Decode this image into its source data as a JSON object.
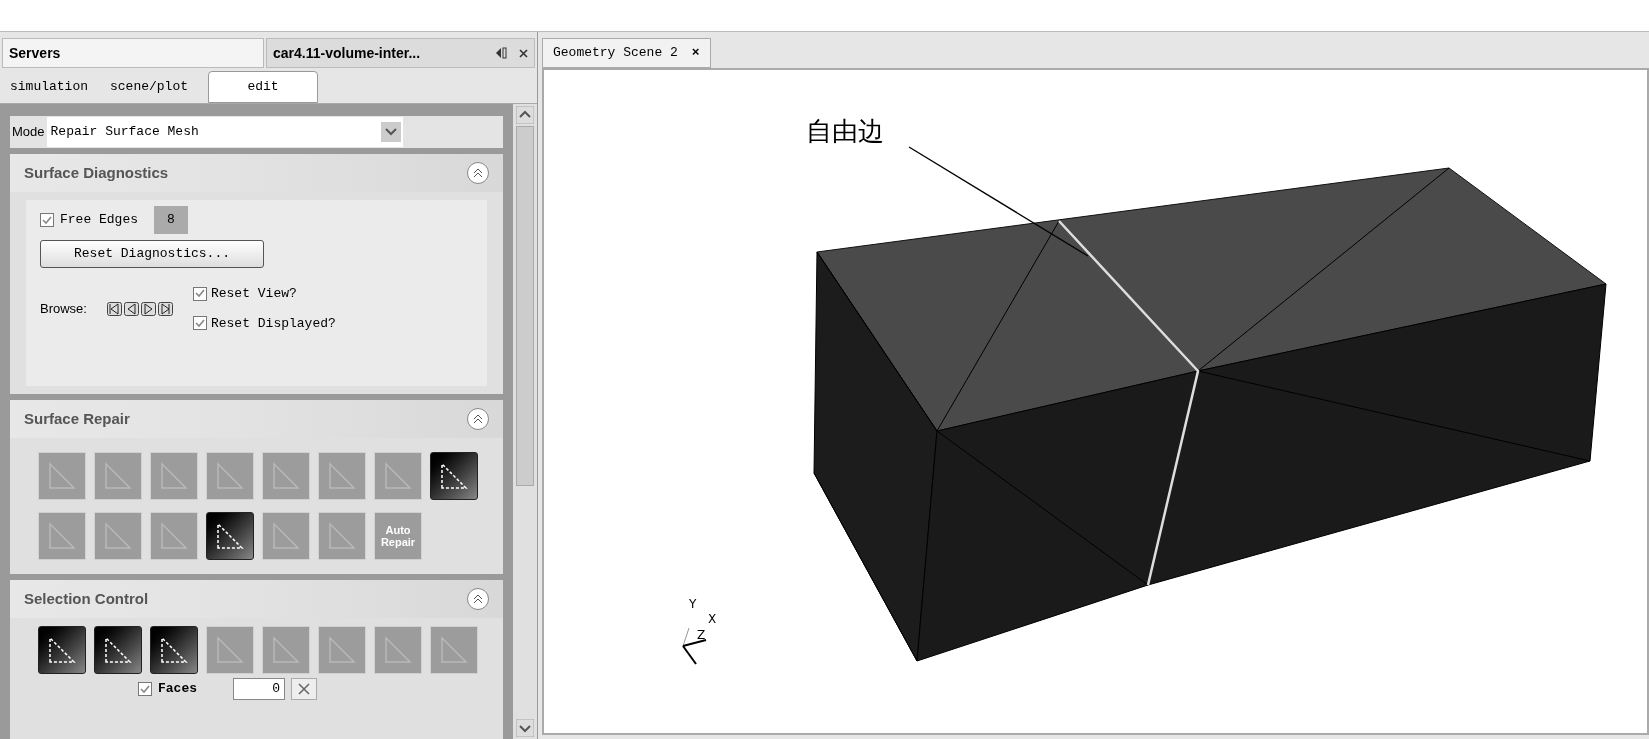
{
  "panel_tabs": [
    {
      "label": "Servers",
      "selected": true
    },
    {
      "label": "car4.11-volume-inter...",
      "selected": false
    }
  ],
  "sub_tabs": [
    {
      "label": "simulation",
      "selected": false
    },
    {
      "label": "scene/plot",
      "selected": false
    },
    {
      "label": "edit",
      "selected": true
    }
  ],
  "mode": {
    "label": "Mode",
    "value": "Repair Surface Mesh"
  },
  "surface_diagnostics": {
    "title": "Surface Diagnostics",
    "expanded": true,
    "free_edges": {
      "label": "Free Edges",
      "checked": true,
      "count": "8"
    },
    "reset_button": "Reset Diagnostics...",
    "browse_label": "Browse:",
    "reset_view": {
      "label": "Reset View?",
      "checked": true
    },
    "reset_displayed": {
      "label": "Reset Displayed?",
      "checked": true
    }
  },
  "surface_repair": {
    "title": "Surface Repair",
    "expanded": true,
    "tools": [
      {
        "selected": false
      },
      {
        "selected": false
      },
      {
        "selected": false
      },
      {
        "selected": false
      },
      {
        "selected": false
      },
      {
        "selected": false
      },
      {
        "selected": false
      },
      {
        "selected": true
      },
      {
        "selected": false
      },
      {
        "selected": false
      },
      {
        "selected": false
      },
      {
        "selected": true
      },
      {
        "selected": false
      },
      {
        "selected": false
      },
      {
        "selected": false,
        "label": "Auto Repair"
      }
    ]
  },
  "selection_control": {
    "title": "Selection Control",
    "expanded": true,
    "tools": [
      {
        "selected": true
      },
      {
        "selected": true
      },
      {
        "selected": true
      },
      {
        "selected": false
      },
      {
        "selected": false
      },
      {
        "selected": false
      },
      {
        "selected": false
      },
      {
        "selected": false
      }
    ],
    "faces": {
      "label": "Faces",
      "checked": true,
      "value": "0"
    }
  },
  "scene_tab": {
    "label": "Geometry Scene 2",
    "close": "×"
  },
  "viewport": {
    "annotation": "自由边",
    "axes": [
      "Y",
      "X",
      "Z"
    ]
  }
}
